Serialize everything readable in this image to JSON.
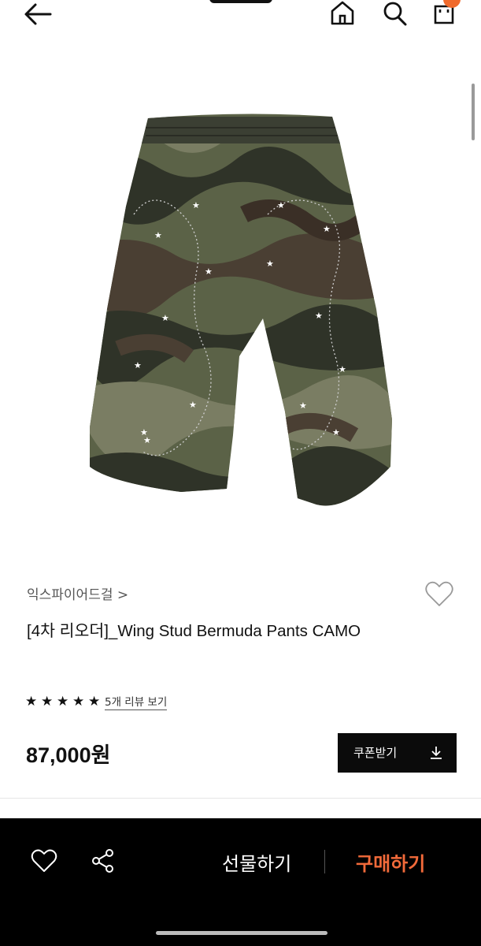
{
  "header": {
    "back_icon": "arrow-left-icon",
    "home_icon": "home-icon",
    "search_icon": "search-icon",
    "cart_icon": "cart-icon"
  },
  "product": {
    "brand": "익스파이어드걸 >",
    "title": "[4차 리오더]_Wing Stud Bermuda Pants CAMO",
    "rating_stars": 5,
    "review_link": "5개 리뷰 보기",
    "price": "87,000원",
    "coupon_button": "쿠폰받기"
  },
  "bottom_bar": {
    "gift_label": "선물하기",
    "buy_label": "구매하기",
    "buy_color": "#f26a3a"
  },
  "colors": {
    "accent": "#f06a2c",
    "camo_dark": "#2f3328",
    "camo_olive": "#5b6247",
    "camo_brown": "#4a3f33"
  }
}
